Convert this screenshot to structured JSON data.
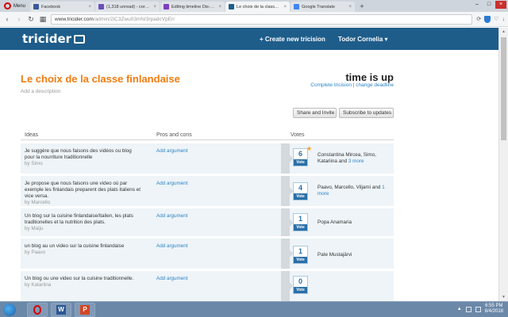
{
  "browser": {
    "menu_label": "Menu",
    "tabs": [
      {
        "label": "Facebook",
        "color": "#3b5998",
        "active": false
      },
      {
        "label": "(1,318 unread) - cornelia...",
        "color": "#6b4fbb",
        "active": false
      },
      {
        "label": "Editing timeline Dis-moi c...",
        "color": "#7b3fbf",
        "active": false
      },
      {
        "label": "Le choix de la classe finlan...",
        "color": "#1e5d8a",
        "active": true
      },
      {
        "label": "Google Translate",
        "color": "#4285f4",
        "active": false
      }
    ],
    "url_host": "www.tricider.com",
    "url_path": "/admin/2iC3Zwu03mN/3rpadcVpErr"
  },
  "site": {
    "logo": "tricider",
    "nav_create": "+ Create new tricision",
    "nav_user": "Todor Cornelia ▾"
  },
  "page": {
    "title": "Le choix de la classe finlandaise",
    "add_description": "Add a description",
    "status": "time is up",
    "complete_link": "Complete tricision",
    "separator": "|",
    "deadline_link": "change deadline",
    "share_button": "Share and Invite",
    "subscribe_button": "Subscribe to updates"
  },
  "table": {
    "headers": {
      "ideas": "Ideas",
      "pros": "Pros and cons",
      "votes": "Votes"
    },
    "rows": [
      {
        "idea": "Je suggère que nous faisons des vidéos ou blog pour la nourriture traditionnelle",
        "by": "by Simo",
        "add_argument": "Add argument",
        "votes": "6",
        "vote_label": "Vote",
        "starred": true,
        "voters": "Constantina Mircea, Simo, Katariina and",
        "more": "3 more"
      },
      {
        "idea": "Je propose que nous faisons une video où par exemple les finlandais preparent des plats italiens et vice versa.",
        "by": "by Marcello",
        "add_argument": "Add argument",
        "votes": "4",
        "vote_label": "Vote",
        "starred": false,
        "voters": "Paavo, Marcello, Viljami and",
        "more": "1 more"
      },
      {
        "idea": "Un blog sur la cuisine finlandaise/italien, les plats traditionelles et la nutrition des plats.",
        "by": "by Maiju",
        "add_argument": "Add argument",
        "votes": "1",
        "vote_label": "Vote",
        "starred": false,
        "voters": "Popa Anamaria",
        "more": ""
      },
      {
        "idea": "un blog au un video sur la cuisine finlandaise",
        "by": "by Paavo",
        "add_argument": "Add argument",
        "votes": "1",
        "vote_label": "Vote",
        "starred": false,
        "voters": "Pate Mustajärvi",
        "more": ""
      },
      {
        "idea": "Un blog ou une video sur la cuisine traditionnelle.",
        "by": "by Katariina",
        "add_argument": "Add argument",
        "votes": "0",
        "vote_label": "Vote",
        "starred": false,
        "voters": "",
        "more": ""
      }
    ]
  },
  "taskbar": {
    "word_label": "W",
    "ppt_label": "P",
    "time": "6:55 PM",
    "date": "8/4/2018"
  }
}
